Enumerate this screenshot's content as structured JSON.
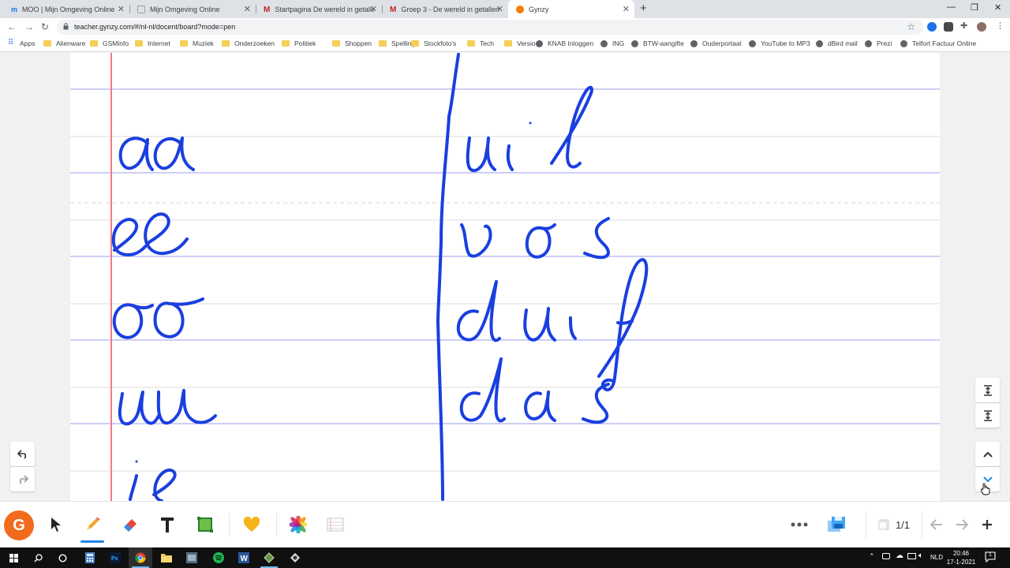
{
  "browser": {
    "tabs": [
      {
        "title": "MOO | Mijn Omgeving Online",
        "color": "#1a73e8"
      },
      {
        "title": "Mijn Omgeving Online",
        "color": "#9aa0a6"
      },
      {
        "title": "Startpagina De wereld in getallen",
        "color": "#c5221f"
      },
      {
        "title": "Groep 3 - De wereld in getallen",
        "color": "#c5221f"
      },
      {
        "title": "Gynzy",
        "color": "#f57c00",
        "active": true
      }
    ],
    "url": "teacher.gynzy.com/#/nl-nl/docent/board?mode=pen",
    "bookmarks": [
      "Apps",
      "Alienware",
      "GSMinfo",
      "Internet",
      "Muziek",
      "Onderzoeken",
      "Politiek",
      "Shoppen",
      "Spelling",
      "Stockfoto's",
      "Tech",
      "Versio",
      "KNAB Inloggen",
      "ING",
      "BTW-aangifte",
      "Ouderportaal",
      "YouTube to MP3",
      "dBird mail",
      "Prezi",
      "Telfort Factuur Online"
    ]
  },
  "board": {
    "ink_color": "#1a3fe0",
    "margin_color": "#f07a86",
    "rule_color": "#9b9ff0",
    "left_column": [
      "aa",
      "ee",
      "oo",
      "uu",
      "ie"
    ],
    "right_column": [
      "uil",
      "vos",
      "duif",
      "das"
    ]
  },
  "toolbar": {
    "logo": "G",
    "page_indicator": "1/1",
    "tools": [
      "select",
      "pen",
      "eraser",
      "text",
      "shapes",
      "stickers",
      "colors",
      "lines"
    ]
  },
  "taskbar": {
    "language": "NLD",
    "time": "20:46",
    "date": "17-1-2021",
    "notifications": "1"
  }
}
